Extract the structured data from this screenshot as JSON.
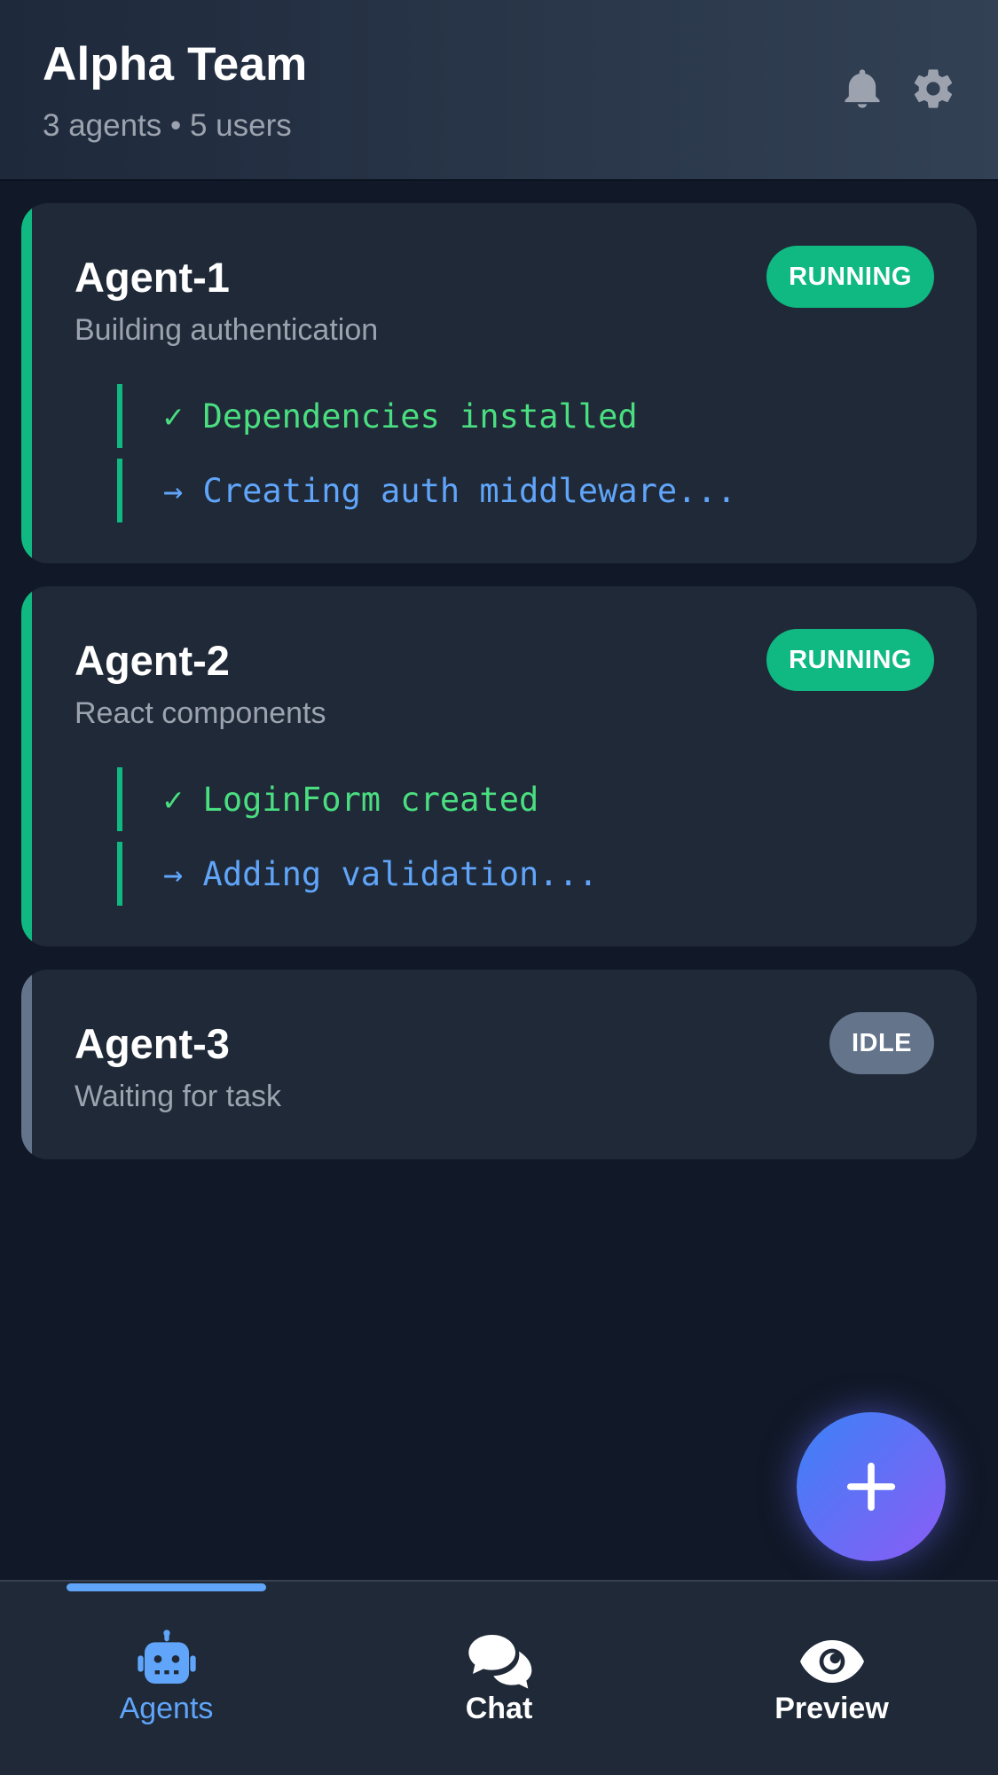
{
  "header": {
    "title": "Alpha Team",
    "subtitle": "3 agents • 5 users",
    "icons": [
      "bell-icon",
      "gear-icon"
    ]
  },
  "agents": [
    {
      "name": "Agent-1",
      "description": "Building authentication",
      "status": "RUNNING",
      "logs": [
        {
          "text": "✓ Dependencies installed",
          "state": "done"
        },
        {
          "text": "→ Creating auth middleware...",
          "state": "active"
        }
      ]
    },
    {
      "name": "Agent-2",
      "description": "React components",
      "status": "RUNNING",
      "logs": [
        {
          "text": "✓ LoginForm created",
          "state": "done"
        },
        {
          "text": "→ Adding validation...",
          "state": "active"
        }
      ]
    },
    {
      "name": "Agent-3",
      "description": "Waiting for task",
      "status": "IDLE",
      "logs": []
    }
  ],
  "fab": {
    "icon": "plus-icon"
  },
  "nav": {
    "items": [
      {
        "label": "Agents",
        "icon": "robot-icon",
        "active": true
      },
      {
        "label": "Chat",
        "icon": "chat-bubbles-icon",
        "active": false
      },
      {
        "label": "Preview",
        "icon": "eye-icon",
        "active": false
      }
    ]
  },
  "colors": {
    "background": "#111827",
    "card": "#1f2937",
    "running": "#10b981",
    "idle": "#64748b",
    "log_done": "#4ade80",
    "log_active": "#60a5fa",
    "nav_active": "#60a5fa",
    "fab_start": "#3b82f6",
    "fab_end": "#8b5cf6"
  }
}
